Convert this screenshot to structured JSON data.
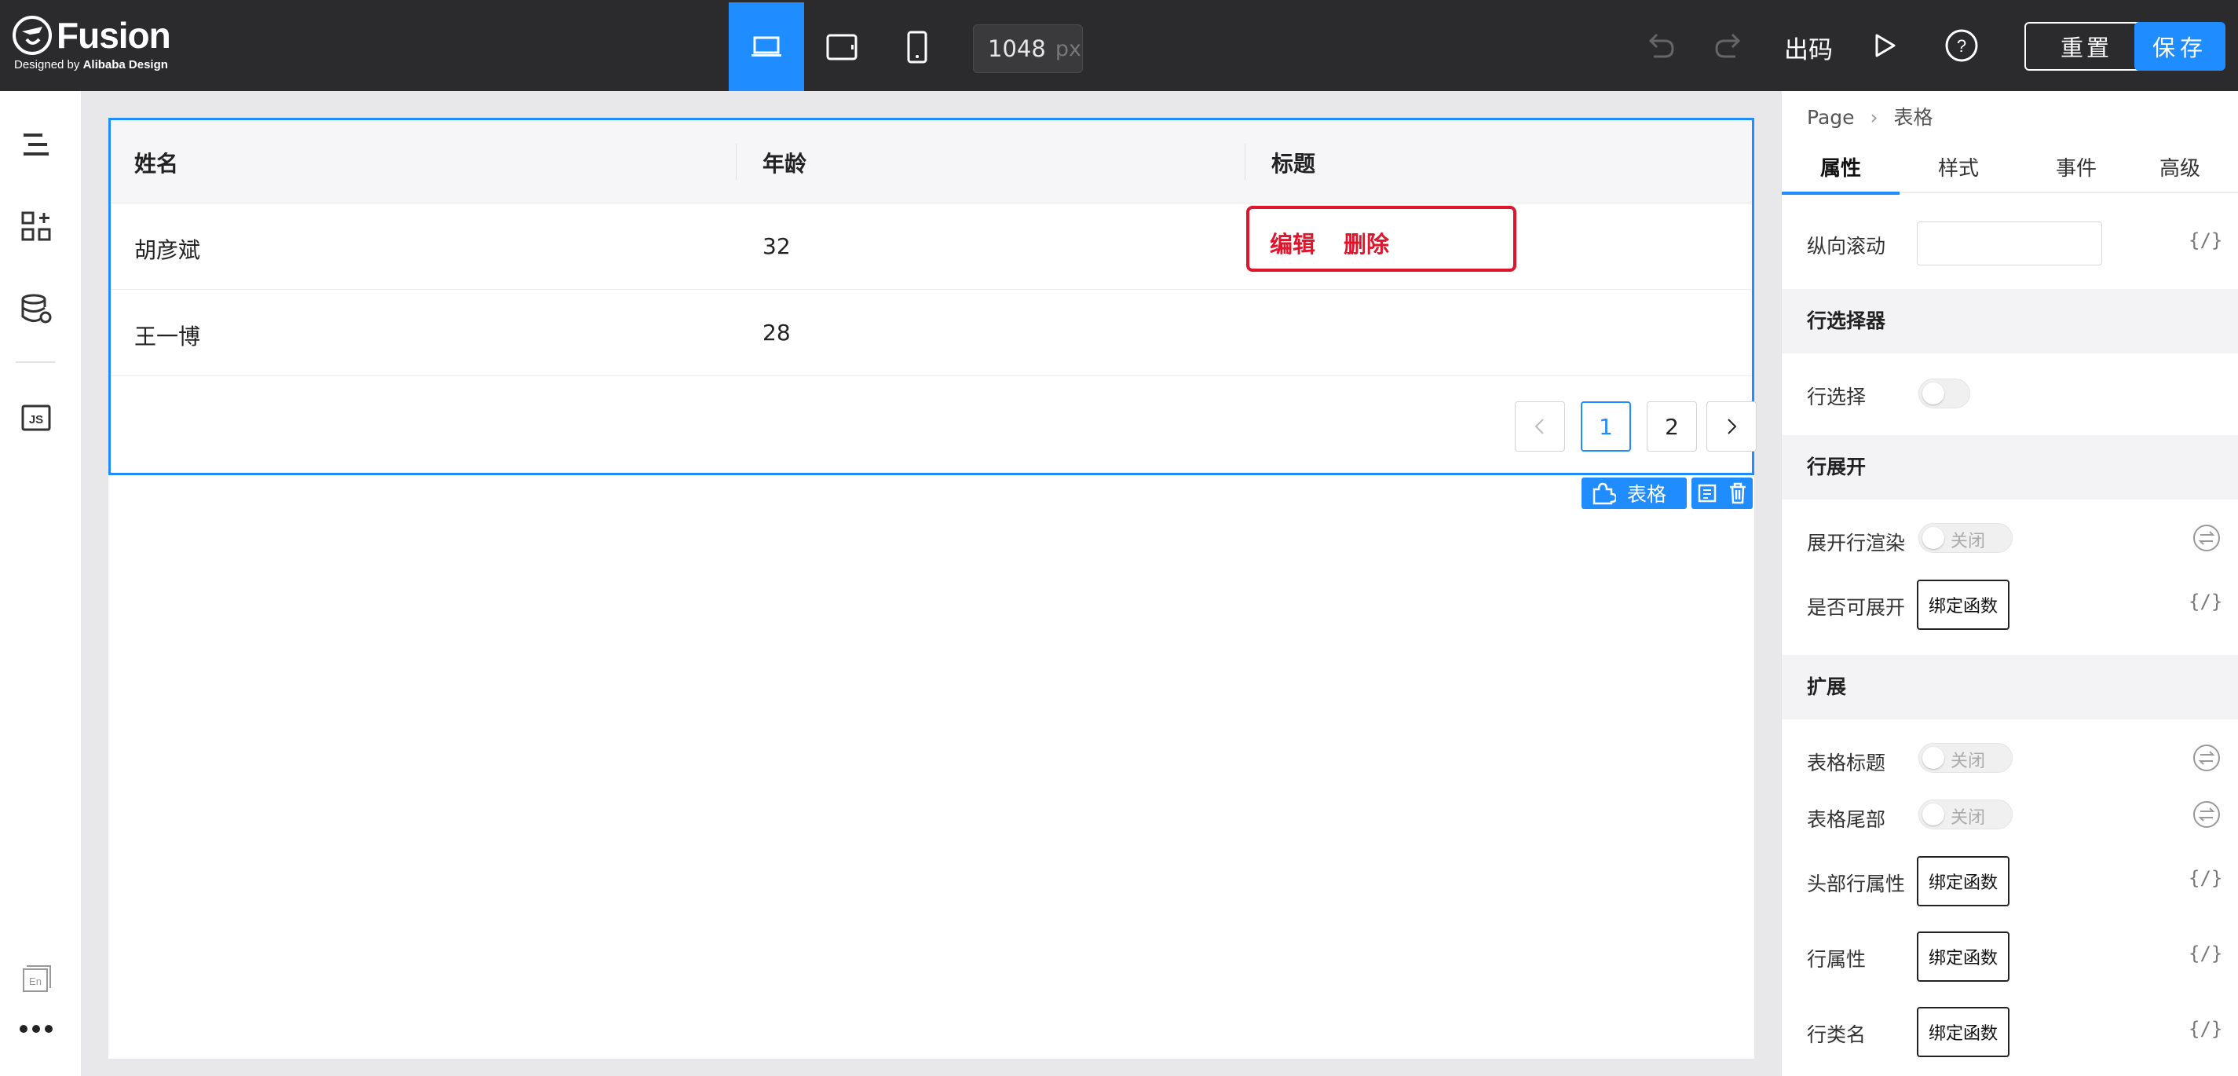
{
  "brand": {
    "name": "Fusion",
    "sub_prefix": "Designed by ",
    "sub_bold": "Alibaba Design"
  },
  "toolbar": {
    "width_value": "1048",
    "width_unit": "px",
    "code_label": "出码",
    "reset_label": "重置",
    "save_label": "保存"
  },
  "table": {
    "columns": [
      "姓名",
      "年龄",
      "标题"
    ],
    "rows": [
      {
        "name": "胡彦斌",
        "age": "32"
      },
      {
        "name": "王一博",
        "age": "28"
      }
    ],
    "actions": [
      "编辑",
      "删除"
    ],
    "pages": [
      "1",
      "2"
    ],
    "current_page": "1",
    "selected_tag": "表格"
  },
  "panel": {
    "breadcrumb": [
      "Page",
      "表格"
    ],
    "tabs": [
      "属性",
      "样式",
      "事件",
      "高级"
    ],
    "active_tab": "属性",
    "var_symbol": "{/}",
    "props": {
      "vertical_scroll": "纵向滚动",
      "row_selector_section": "行选择器",
      "row_select": "行选择",
      "row_expand_section": "行展开",
      "expand_render": "展开行渲染",
      "expandable": "是否可展开",
      "extend_section": "扩展",
      "table_title": "表格标题",
      "table_footer": "表格尾部",
      "header_row_props": "头部行属性",
      "row_props": "行属性",
      "row_class": "行类名"
    },
    "toggle_off": "关闭",
    "bind_function": "绑定函数"
  },
  "colors": {
    "topbar": "#2b2b2d",
    "accent": "#1f8cff",
    "highlight_red": "#e0152b"
  },
  "icons": [
    "logo-icon",
    "desktop-icon",
    "tablet-icon",
    "mobile-icon",
    "undo-icon",
    "redo-icon",
    "play-icon",
    "help-icon",
    "outline-icon",
    "components-icon",
    "datasource-icon",
    "js-icon",
    "language-icon",
    "more-icon",
    "component-icon",
    "copy-icon",
    "trash-icon",
    "swap-icon"
  ]
}
